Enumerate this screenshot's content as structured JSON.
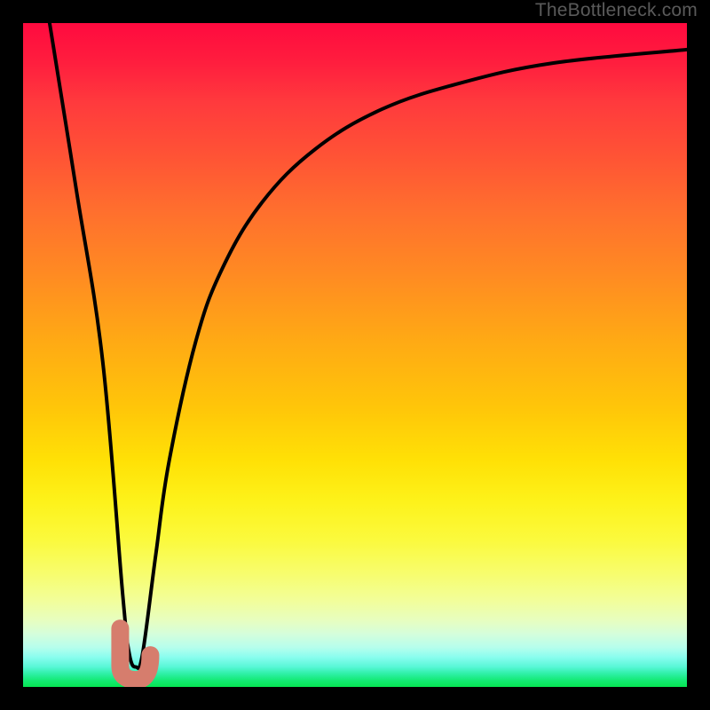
{
  "watermark": "TheBottleneck.com",
  "colors": {
    "frame": "#000000",
    "curve_stroke": "#000000",
    "marker_fill": "#d67d6d",
    "marker_stroke": "#d67d6d"
  },
  "chart_data": {
    "type": "line",
    "title": "",
    "xlabel": "",
    "ylabel": "",
    "xlim": [
      0,
      100
    ],
    "ylim": [
      0,
      100
    ],
    "grid": false,
    "legend": false,
    "note": "Axes are unlabeled percentage-like scales; y values estimated from pixel positions (0 = bottom, 100 = top).",
    "series": [
      {
        "name": "curve",
        "x": [
          4,
          8,
          12,
          15,
          16,
          17,
          18,
          20,
          22,
          26,
          30,
          36,
          44,
          54,
          66,
          80,
          100
        ],
        "y": [
          100,
          75,
          49,
          14,
          5,
          3,
          5,
          20,
          34,
          52,
          63,
          73,
          81,
          87,
          91,
          94,
          96
        ]
      }
    ],
    "marker": {
      "name": "j-marker",
      "description": "Thick salmon J-shaped marker near curve minimum",
      "approx_center_x": 16.5,
      "approx_center_y": 4,
      "dot": {
        "x": 14.5,
        "y": 8
      }
    }
  }
}
